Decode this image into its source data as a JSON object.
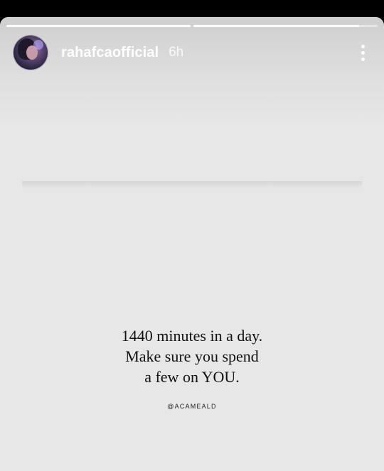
{
  "story": {
    "progress": [
      {
        "fill": 1.0
      },
      {
        "fill": 0.9
      }
    ],
    "header": {
      "username": "rahafcaofficial",
      "time": "6h",
      "avatar_icon": "profile-photo",
      "menu_icon": "more-vertical-icon"
    },
    "quote": {
      "line1": "1440 minutes in a day.",
      "line2": "Make sure you spend",
      "line3": "a few on YOU."
    },
    "credit": "@ACAMEALD"
  },
  "colors": {
    "background": "#e7e7e7",
    "text": "#111111",
    "header_text": "#ffffff"
  }
}
